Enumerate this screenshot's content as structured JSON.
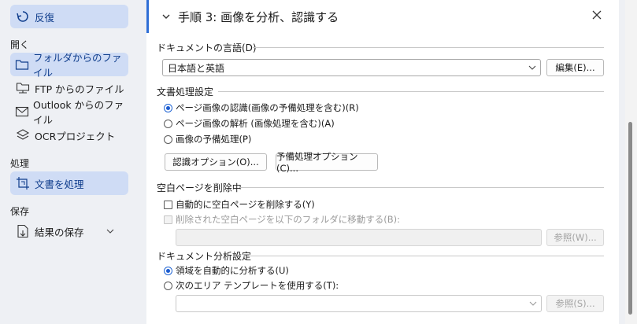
{
  "sidebar": {
    "back_label": "反復",
    "section_open": "開く",
    "open_items": [
      {
        "label": "フォルダからのファイル",
        "icon": "folder-icon",
        "selected": true
      },
      {
        "label": "FTP からのファイル",
        "icon": "ftp-folder-icon",
        "selected": false
      },
      {
        "label": "Outlook からのファイル",
        "icon": "mail-icon",
        "selected": false
      },
      {
        "label": "OCRプロジェクト",
        "icon": "layers-icon",
        "selected": false
      }
    ],
    "section_process": "処理",
    "process_item": {
      "label": "文書を処理",
      "icon": "crop-icon",
      "selected": true
    },
    "section_save": "保存",
    "save_item": {
      "label": "結果の保存",
      "icon": "save-document-icon",
      "selected": false
    }
  },
  "step": {
    "title": "手順 3: 画像を分析、認識する",
    "language_group": "ドキュメントの言語(D)",
    "language_value": "日本語と英語",
    "edit_button": "編集(E)...",
    "processing_group": "文書処理設定",
    "radio_recognize": "ページ画像の認識(画像の予備処理を含む)(R)",
    "radio_analyze": "ページ画像の解析 (画像処理を含む)(A)",
    "radio_preprocess": "画像の予備処理(P)",
    "recognition_options_button": "認識オプション(O)...",
    "preprocess_options_button": "予備処理オプション(C)...",
    "blank_group": "空白ページを削除中",
    "auto_delete_blank": "自動的に空白ページを削除する(Y)",
    "move_deleted_blank": "削除された空白ページを以下のフォルダに移動する(B):",
    "browse_button_1": "参照(W)...",
    "analysis_group": "ドキュメント分析設定",
    "radio_auto_analyze": "領域を自動的に分析する(U)",
    "radio_use_template": "次のエリア テンプレートを使用する(T):",
    "browse_button_2": "参照(S)..."
  },
  "colors": {
    "accent": "#2f6fd6",
    "selected_bg": "#cfdcf5",
    "sidebar_bg": "#eef0f4"
  }
}
